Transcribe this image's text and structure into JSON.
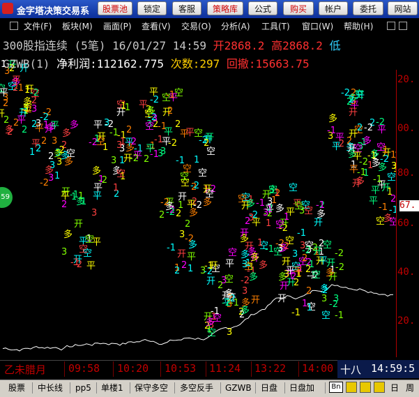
{
  "app": {
    "title": "金字塔决策交易系"
  },
  "toolbar": {
    "stock_pool": "股票池",
    "lock": "锁定",
    "service": "客服",
    "strategy": "策略库",
    "formula": "公式",
    "buy": "购买",
    "account": "帐户",
    "delegate": "委托",
    "website": "网站"
  },
  "menu": {
    "file": "文件(F)",
    "block": "板块(M)",
    "view_pane": "画面(P)",
    "view": "查看(V)",
    "trade": "交易(O)",
    "analysis": "分析(A)",
    "tools": "工具(T)",
    "window": "窗口(W)",
    "help": "帮助(H)"
  },
  "header": {
    "line1_name": "300股指连续",
    "line1_period": "(5笔)",
    "line1_date": "16/01/27",
    "line1_time": "14:59",
    "line1_open": "开2868.2",
    "line1_high": "高2868.2",
    "line1_low": "低",
    "line2_indicator": "GZWB(1)",
    "line2_profit": "净利润:112162.775",
    "line2_count": "次数:297",
    "line2_drawdown": "回撤:15663.75"
  },
  "y_axis": {
    "labels": [
      "20.",
      "00.",
      "80.",
      "60.",
      "40.",
      "20."
    ]
  },
  "price_tag": "67.",
  "badge": "59",
  "timebar": {
    "date": "乙未腊月",
    "times": [
      "09:58",
      "10:20",
      "10:53",
      "11:24",
      "13:22",
      "14:00"
    ],
    "day": "十八",
    "clock": "14:59:5"
  },
  "tabs": [
    "股票",
    "中长线",
    "pp5",
    "单楼1",
    "保守多空",
    "多空反手",
    "GZWB",
    "日盘",
    "日盘加"
  ],
  "bottom_icons": {
    "bn": "Bn",
    "day": "日",
    "week": "周"
  },
  "colors": {
    "axis": "#c00000",
    "equity_curve": "#ffffff"
  }
}
